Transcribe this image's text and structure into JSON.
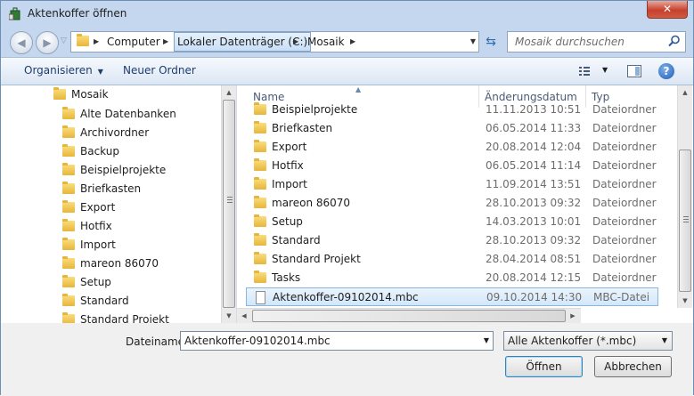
{
  "window": {
    "title": "Aktenkoffer öffnen",
    "close_label": "✕"
  },
  "nav": {
    "breadcrumb": [
      "Computer",
      "Lokaler Datenträger (C:)",
      "Mosaik"
    ],
    "search_placeholder": "Mosaik durchsuchen"
  },
  "toolbar": {
    "organize_label": "Organisieren",
    "new_folder_label": "Neuer Ordner"
  },
  "tree": {
    "root": "Mosaik",
    "items": [
      "Alte Datenbanken",
      "Archivordner",
      "Backup",
      "Beispielprojekte",
      "Briefkasten",
      "Export",
      "Hotfix",
      "Import",
      "mareon 86070",
      "Setup",
      "Standard",
      "Standard Projekt"
    ]
  },
  "columns": {
    "name": "Name",
    "date": "Änderungsdatum",
    "type": "Typ"
  },
  "files": [
    {
      "name": "Beispielprojekte",
      "date": "11.11.2013 10:51",
      "type": "Dateiordner",
      "kind": "folder"
    },
    {
      "name": "Briefkasten",
      "date": "06.05.2014 11:33",
      "type": "Dateiordner",
      "kind": "folder"
    },
    {
      "name": "Export",
      "date": "20.08.2014 12:04",
      "type": "Dateiordner",
      "kind": "folder"
    },
    {
      "name": "Hotfix",
      "date": "06.05.2014 11:14",
      "type": "Dateiordner",
      "kind": "folder"
    },
    {
      "name": "Import",
      "date": "11.09.2014 13:51",
      "type": "Dateiordner",
      "kind": "folder"
    },
    {
      "name": "mareon 86070",
      "date": "28.10.2013 09:32",
      "type": "Dateiordner",
      "kind": "folder"
    },
    {
      "name": "Setup",
      "date": "14.03.2013 10:01",
      "type": "Dateiordner",
      "kind": "folder"
    },
    {
      "name": "Standard",
      "date": "28.10.2013 09:32",
      "type": "Dateiordner",
      "kind": "folder"
    },
    {
      "name": "Standard Projekt",
      "date": "28.04.2014 08:51",
      "type": "Dateiordner",
      "kind": "folder"
    },
    {
      "name": "Tasks",
      "date": "20.08.2014 12:15",
      "type": "Dateiordner",
      "kind": "folder"
    },
    {
      "name": "Aktenkoffer-09102014.mbc",
      "date": "09.10.2014 14:30",
      "type": "MBC-Datei",
      "kind": "file",
      "selected": true
    }
  ],
  "bottom": {
    "filename_label": "Dateiname:",
    "filename_value": "Aktenkoffer-09102014.mbc",
    "filter_value": "Alle Aktenkoffer (*.mbc)",
    "open_label": "Öffnen",
    "cancel_label": "Abbrechen"
  }
}
